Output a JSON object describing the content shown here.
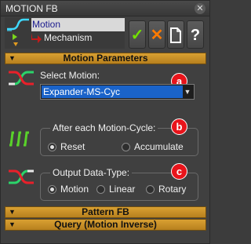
{
  "window": {
    "title": "MOTION FB",
    "close_glyph": "✕"
  },
  "tree": {
    "items": [
      {
        "label": "Motion",
        "icon": "motion-curve-icon",
        "selected": true
      },
      {
        "label": "Mechanism",
        "icon": "mechanism-arrow-icon",
        "selected": false
      }
    ]
  },
  "toolbar": {
    "ok_glyph": "✓",
    "cancel_glyph": "✕",
    "help_glyph": "?"
  },
  "sections": {
    "motion_parameters": "Motion Parameters",
    "pattern_fb": "Pattern FB",
    "query": "Query (Motion Inverse)",
    "collapse_glyph": "▼"
  },
  "select_motion": {
    "label": "Select Motion:",
    "value": "Expander-MS-Cyc",
    "dropdown_glyph": "▼"
  },
  "after_cycle": {
    "title": "After each Motion-Cycle:",
    "options": [
      "Reset",
      "Accumulate"
    ],
    "selected": "Reset"
  },
  "output_type": {
    "title": "Output Data-Type:",
    "options": [
      "Motion",
      "Linear",
      "Rotary"
    ],
    "selected": "Motion"
  },
  "badges": [
    "a",
    "b",
    "c"
  ],
  "colors": {
    "accent_gold": "#c8901f",
    "selection_blue": "#1a63c9",
    "badge_red": "#e8141b",
    "ok_green": "#73e000",
    "cancel_orange": "#ff7a00"
  }
}
